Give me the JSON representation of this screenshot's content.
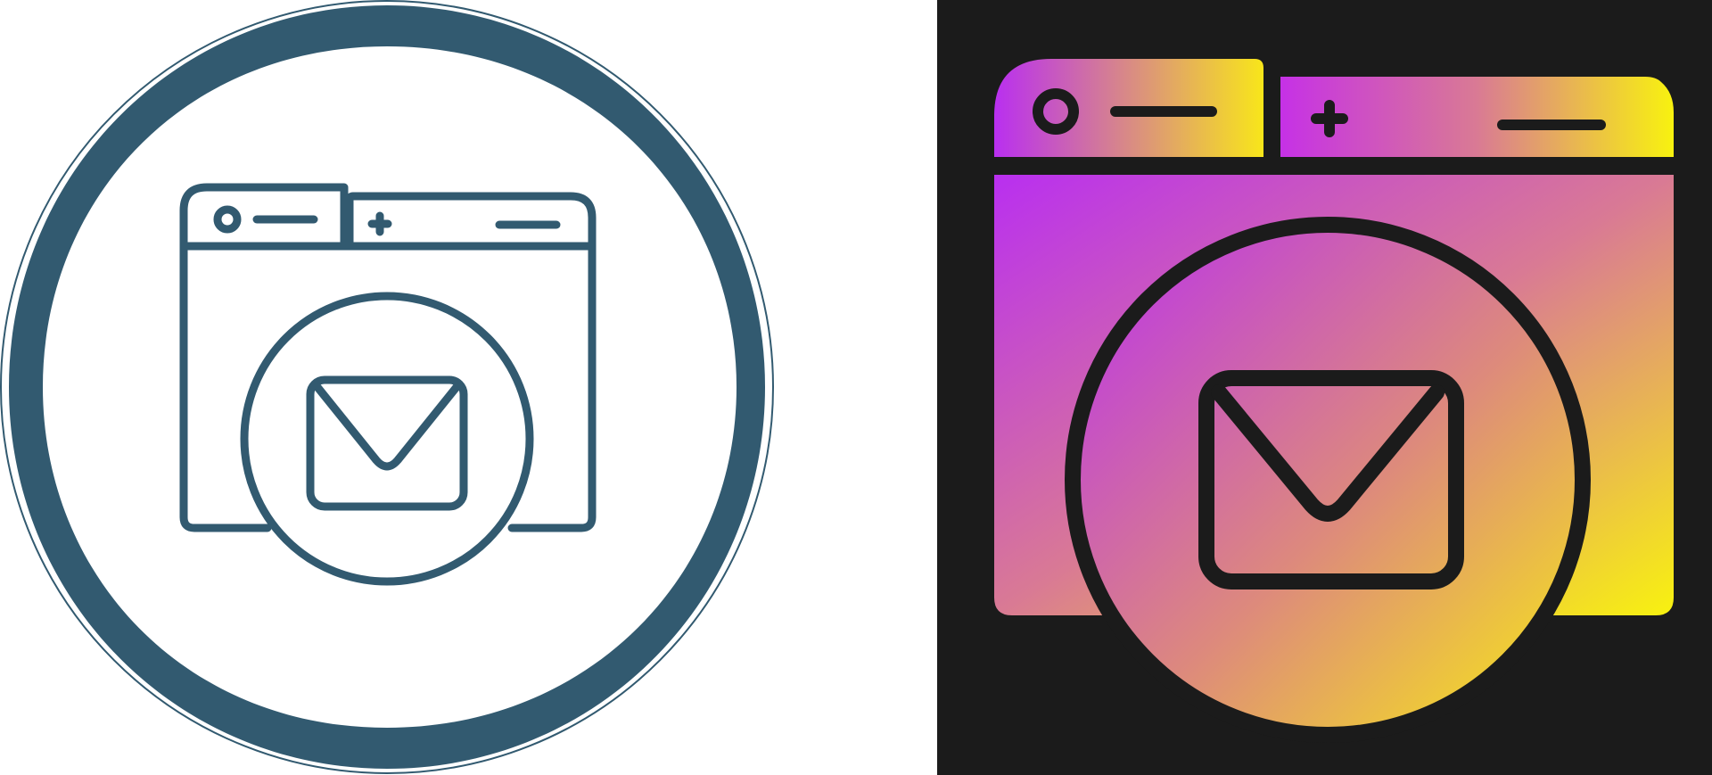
{
  "icons": [
    {
      "name": "email-website-line-icon",
      "style": "outline",
      "background": "#ffffff",
      "stroke_color": "#325a70"
    },
    {
      "name": "email-website-gradient-icon",
      "style": "glyph-gradient",
      "background": "#1b1b1b",
      "stroke_color": "#1b1b1b",
      "gradient_colors": [
        "#b92ff0",
        "#d97a94",
        "#f8f20f"
      ]
    }
  ]
}
